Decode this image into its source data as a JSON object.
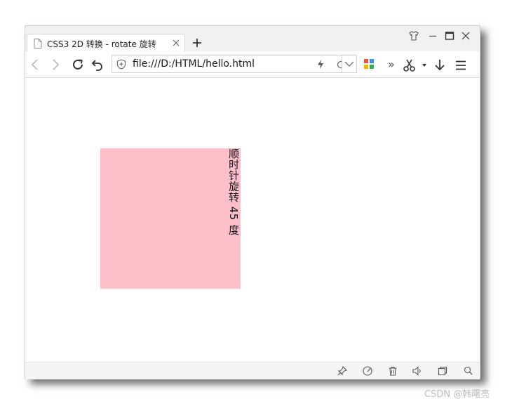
{
  "tab": {
    "title": "CSS3 2D 转换 - rotate 旋转"
  },
  "address_bar": {
    "url": "file:///D:/HTML/hello.html"
  },
  "toolbar": {
    "more_label": "»"
  },
  "page": {
    "box_color": "#ffc0cb",
    "box_text": "顺时针旋转 45 度"
  },
  "watermark": {
    "text": "CSDN @韩曙亮"
  },
  "icons": {
    "titlebar": [
      "document-icon",
      "tab-close-icon",
      "new-tab-icon",
      "skin-icon",
      "minimize-icon",
      "maximize-icon",
      "close-window-icon"
    ],
    "toolbar": [
      "back-icon",
      "forward-icon",
      "reload-icon",
      "undo-icon",
      "shield-icon",
      "lightning-icon",
      "search-icon",
      "dropdown-icon",
      "apps-icon",
      "scissors-icon",
      "download-icon",
      "menu-icon"
    ],
    "statusbar": [
      "pin-icon",
      "speedometer-icon",
      "trash-icon",
      "speaker-icon",
      "window-icon",
      "zoom-icon"
    ]
  }
}
